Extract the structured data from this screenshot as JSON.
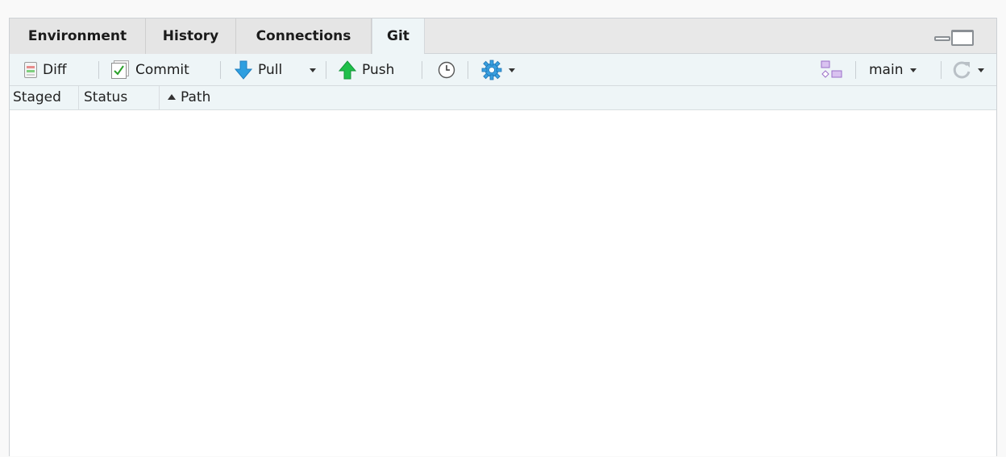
{
  "tabs": [
    {
      "label": "Environment",
      "active": false
    },
    {
      "label": "History",
      "active": false
    },
    {
      "label": "Connections",
      "active": false
    },
    {
      "label": "Git",
      "active": true
    }
  ],
  "toolbar": {
    "diff_label": "Diff",
    "commit_label": "Commit",
    "pull_label": "Pull",
    "push_label": "Push",
    "branch_label": "main"
  },
  "icons": {
    "diff": "diff-icon",
    "commit": "commit-checkbox-icon",
    "pull": "pull-arrow-down-icon",
    "push": "push-arrow-up-icon",
    "history": "clock-icon",
    "settings": "gear-icon",
    "branch": "branch-icon",
    "refresh": "refresh-icon",
    "minimize": "minimize-icon",
    "maximize": "maximize-icon"
  },
  "columns": {
    "staged": "Staged",
    "status": "Status",
    "path": "Path",
    "sort_column": "Path",
    "sort_direction": "ascending"
  },
  "files": [],
  "colors": {
    "pull_arrow": "#2e9fe0",
    "push_arrow": "#1fbf4a",
    "gear": "#3aa0e0",
    "branch": "#b58ad8",
    "toolbar_bg": "#eef5f7"
  }
}
